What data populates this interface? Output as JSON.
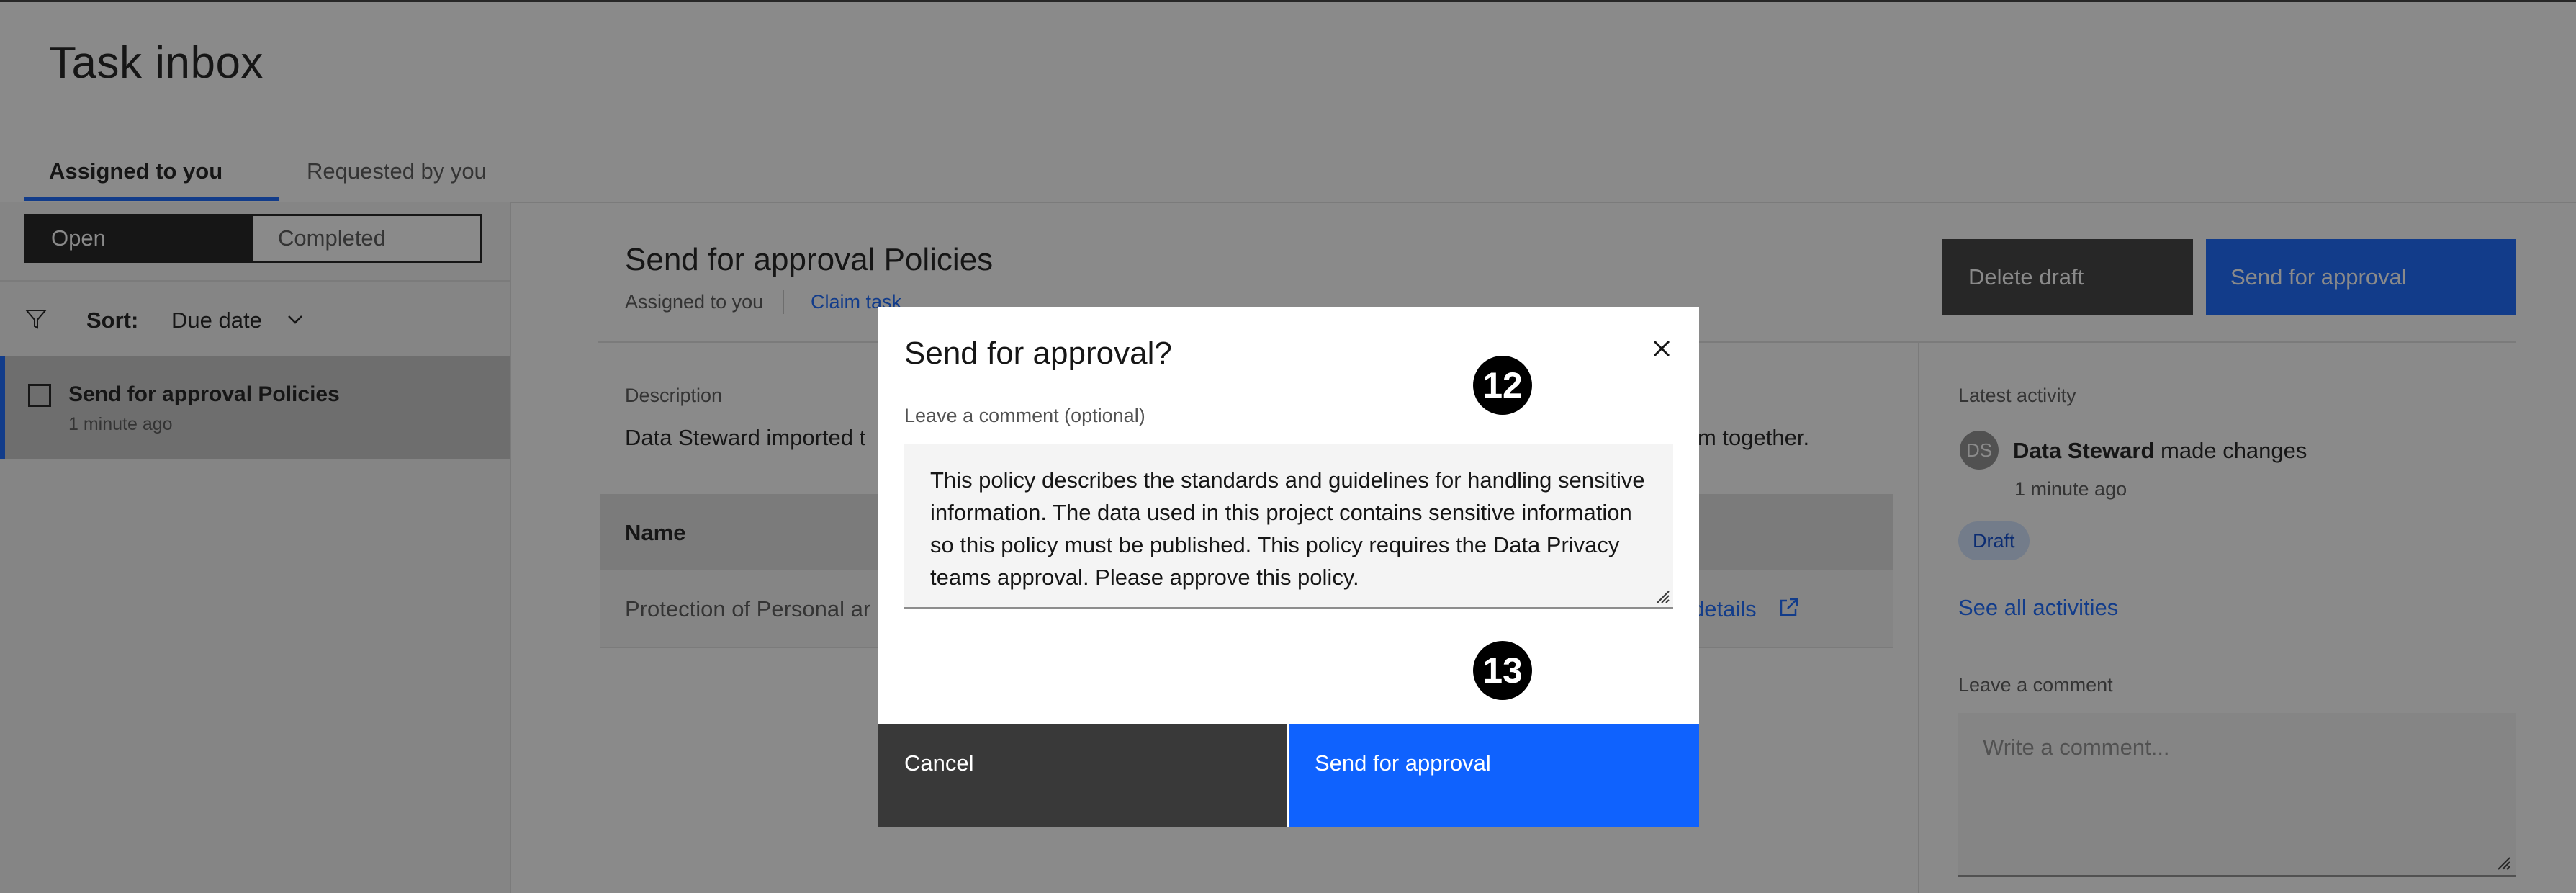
{
  "page": {
    "title": "Task inbox"
  },
  "tabs": [
    {
      "label": "Assigned to you",
      "active": true
    },
    {
      "label": "Requested by you",
      "active": false
    }
  ],
  "segment": {
    "open": "Open",
    "completed": "Completed"
  },
  "sort": {
    "label": "Sort:",
    "value": "Due date"
  },
  "task_list": [
    {
      "title": "Send for approval Policies",
      "time": "1 minute ago"
    }
  ],
  "task": {
    "title": "Send for approval Policies",
    "assigned": "Assigned to you",
    "claim": "Claim task",
    "delete_label": "Delete draft",
    "send_label": "Send for approval",
    "description_label": "Description",
    "description_start": "Data Steward imported t",
    "description_end": "m together.",
    "table": {
      "header": "Name",
      "row_name": "Protection of Personal ar",
      "row_link": "details"
    }
  },
  "activity": {
    "label": "Latest activity",
    "avatar": "DS",
    "actor": "Data Steward",
    "action": "made changes",
    "time": "1 minute ago",
    "tag": "Draft",
    "see_all": "See all activities",
    "comment_label": "Leave a comment",
    "comment_placeholder": "Write a comment..."
  },
  "modal": {
    "title": "Send for approval?",
    "comment_label": "Leave a comment (optional)",
    "comment_value": "This policy describes the standards and guidelines for handling sensitive information. The data used in this project contains sensitive information so this policy must be published. This policy requires the Data Privacy teams approval. Please approve this policy.",
    "cancel": "Cancel",
    "send": "Send for approval"
  },
  "callouts": {
    "first": "12",
    "second": "13"
  },
  "colors": {
    "primary": "#0f62fe",
    "dark": "#393939",
    "tag_bg": "#d0e2ff"
  },
  "icons": [
    "filter-icon",
    "chevron-down-icon",
    "launch-icon",
    "close-icon",
    "resize-grip-icon"
  ]
}
